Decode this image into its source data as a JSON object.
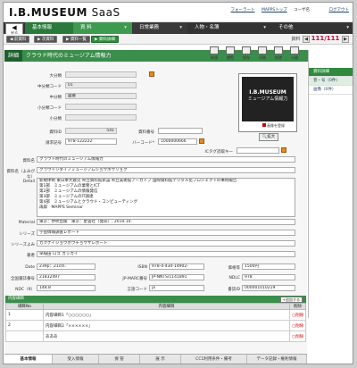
{
  "header": {
    "logo": "I.B.MUSEUM",
    "logo_suffix": "SaaS",
    "links": [
      "フォーラート",
      "MAPPSトップ"
    ],
    "user": "ユーザ名",
    "logout": "ログアウト"
  },
  "nav": {
    "back_arrow": "◀",
    "back_label": "戻る",
    "tabs": [
      {
        "label": "基本情報"
      },
      {
        "label": "資 料"
      },
      {
        "label": "日常業務"
      },
      {
        "label": "人物・名簿"
      },
      {
        "label": "その他"
      }
    ]
  },
  "subnav": {
    "prev": "前資料",
    "next": "次資料",
    "list": "資料一覧",
    "detail": "資料詳細",
    "pager_label": "資料",
    "pager_current": "111",
    "pager_total": "/111",
    "prev_arrow": "◀",
    "next_arrow": "▶"
  },
  "title": {
    "tag": "詳細",
    "text": "クラウド時代のミュージアム情報力"
  },
  "tools": [
    "新規",
    "閲覧",
    "保存",
    "印刷",
    "削除",
    "公開"
  ],
  "side": [
    "資料詳細",
    "巻・号（0件）",
    "画像（0件）"
  ],
  "form": {
    "dai_bunrui": "大分類",
    "chu1": "中分類コード",
    "chu1_val": "01",
    "chu2": "中分類",
    "chu2_val": "図書",
    "sho1": "小分類コード",
    "sho2": "小分類",
    "shiryo_id_label": "資料ID",
    "shiryo_id": "541",
    "shiryo_no_label": "資料番号",
    "seikyu_label": "請求記号",
    "seikyu": "978-122222",
    "barcode_label": "バーコード",
    "barcode": "1000000666",
    "ictag_label": "ICタグ読取キー",
    "shiryomei_label": "資料名",
    "shiryomei": "クラウド時代のミュージアム情報力",
    "yomi_label": "資料名（よみがな）",
    "yomi": "クラウドジダイノミュージアムジョウホウリョク",
    "detail_label": "Detail",
    "detail_lines": [
      "新規体制 東日本大震災 県立資料館新設 県立美術館アーカイブ 国際資料館デジタル化プロジェクトの事例報告",
      "第1部　ミュージアムの業務とICT",
      "第2部　ミュージアムの情報発信",
      "第3部　ミュージアムのIT調達",
      "第4部　ミュージアムとクラウド・コンピューティング",
      "再録　MAPPS Seminar"
    ],
    "material_label": "Material",
    "material": "東京：伊吹出版　東京：星雲社（発売）, 2010.10.",
    "series_label": "シリーズ",
    "series": "学芸情報調査レポート",
    "series_yomi_label": "シリーズよみ",
    "series_yomi": "ガクゲイジョウホウチョウサレポート",
    "author_label": "著者",
    "author": "早稲田 ロゴ ガッカイ",
    "date_label": "Date",
    "date": "239p：21cm.",
    "isbn_label": "ISBN",
    "isbn": "978-4-434-14902-",
    "price_label": "価格等",
    "price": "1500円",
    "zenkoku_label": "全国書誌番号",
    "zenkoku": "21832497",
    "jpmarc_label": "JP-MARC番号",
    "jpmarc": "JP-NNTS/1141891",
    "ndlc_label": "NDLC",
    "ndlc": "978",
    "ndc_label": "NDC（9）",
    "ndc": "148.8",
    "lang_label": "言語コード",
    "lang": "ja",
    "shoshi_label": "書誌ID",
    "shoshi": "000001010219"
  },
  "image": {
    "title": "I.B.MUSEUM",
    "subtitle": "ミュージアム情報力",
    "register": "画像を登録",
    "zoom": "拡大"
  },
  "toc": {
    "section": "内容細目",
    "add": "+追加する",
    "col_no": "細目No",
    "col_content": "内容細目",
    "col_del": "削除",
    "rows": [
      {
        "no": "1",
        "text": "内容細目1「○○○○○○」"
      },
      {
        "no": "2",
        "text": "内容細目2「××××××」"
      },
      {
        "no": "",
        "text": "あああ"
      }
    ],
    "del_label": "削除"
  },
  "bottom_tabs": [
    "基本情報",
    "受入情報",
    "保 管",
    "展 示",
    "CC1利用条件・備考",
    "データ記録・権利情報"
  ],
  "colors": {
    "accent": "#3a8d4a",
    "nav": "#333333",
    "required": "#cc0000"
  }
}
